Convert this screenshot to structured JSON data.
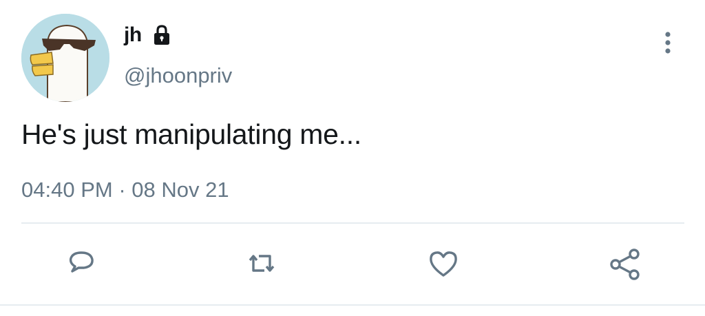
{
  "tweet": {
    "display_name": "jh",
    "handle": "@jhoonpriv",
    "text": "He's just manipulating me...",
    "time": "04:40 PM",
    "separator": "·",
    "date": "08 Nov 21",
    "protected": true
  },
  "icons": {
    "avatar": "duck-with-sunglasses-avatar",
    "lock": "lock-icon",
    "more": "more-vertical-icon",
    "reply": "reply-icon",
    "retweet": "retweet-icon",
    "like": "heart-icon",
    "share": "share-icon"
  },
  "colors": {
    "text_primary": "#14171a",
    "text_secondary": "#657786",
    "divider": "#e6ecf0",
    "avatar_bg": "#b9dde6"
  }
}
